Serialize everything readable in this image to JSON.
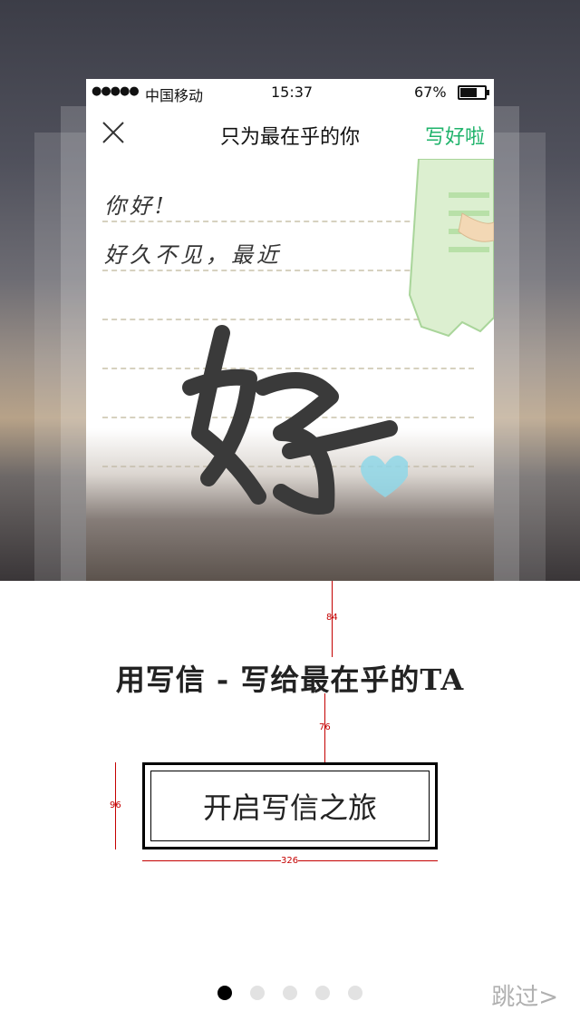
{
  "phone": {
    "status_bar": {
      "signal": "●●●●●",
      "carrier": "中国移动",
      "time": "15:37",
      "battery": "67%"
    },
    "nav": {
      "title": "只为最在乎的你",
      "done_label": "写好啦"
    },
    "letter": {
      "line1": "你好!",
      "line2": "好久不见，最近"
    }
  },
  "annotations": {
    "gap_top": "84",
    "gap_bottom": "76",
    "button_height": "96",
    "button_width": "326"
  },
  "headline": "用写信 - 写给最在乎的TA",
  "start_button": {
    "label": "开启写信之旅"
  },
  "pager": {
    "count": 5,
    "active": 0
  },
  "skip_label": "跳过>",
  "colors": {
    "accent_green": "#1fb36b",
    "annotation_red": "#c40000"
  }
}
